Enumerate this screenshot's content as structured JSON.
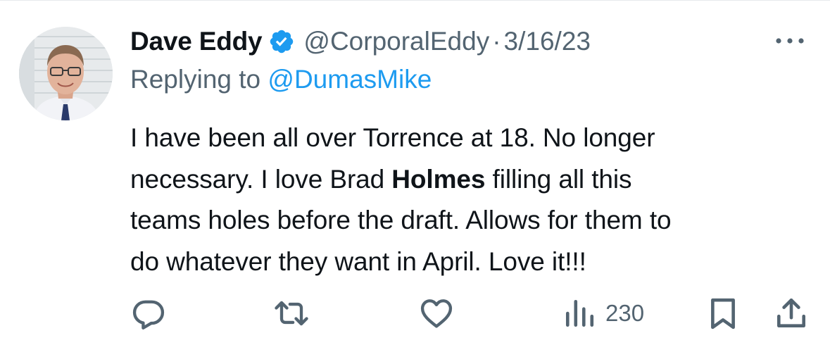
{
  "tweet": {
    "author": {
      "display_name": "Dave Eddy",
      "handle": "@CorporalEddy",
      "verified": true
    },
    "separator": "·",
    "date": "3/16/23",
    "replying_to_prefix": "Replying to ",
    "replying_to_handle": "@DumasMike",
    "text_before_bold": "I have been all over Torrence at 18. No longer\nnecessary. I love Brad ",
    "text_bold": "Holmes",
    "text_after_bold": " filling all this\nteams holes before the draft. Allows for them to\ndo whatever they want in April. Love it!!!"
  },
  "actions": {
    "views_count": "230"
  },
  "colors": {
    "text_primary": "#0f1419",
    "text_secondary": "#536471",
    "accent": "#1d9bf0"
  },
  "icons": [
    "verified-badge-icon",
    "more-icon",
    "reply-icon",
    "retweet-icon",
    "like-icon",
    "views-icon",
    "bookmark-icon",
    "share-icon"
  ]
}
